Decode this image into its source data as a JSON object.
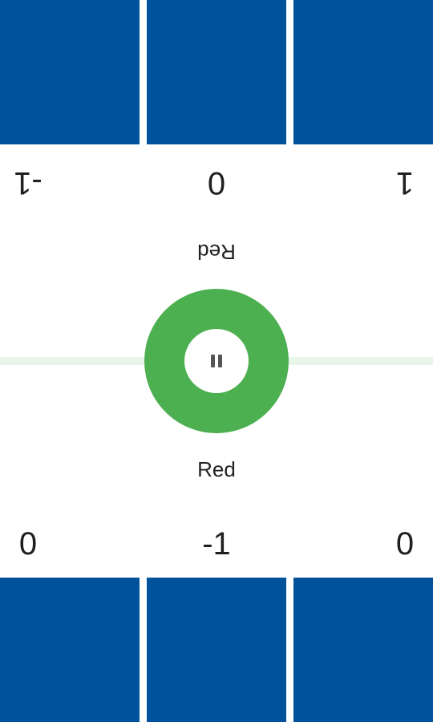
{
  "colors": {
    "tile": "#00529b",
    "ring": "#4caf50",
    "divider": "#e8f5e9",
    "background": "#ffffff"
  },
  "top_player": {
    "label": "Red",
    "scores": [
      "1",
      "0",
      "-1"
    ]
  },
  "bottom_player": {
    "label": "Red",
    "scores": [
      "0",
      "-1",
      "0"
    ]
  },
  "center_control": {
    "icon": "pause-icon"
  }
}
